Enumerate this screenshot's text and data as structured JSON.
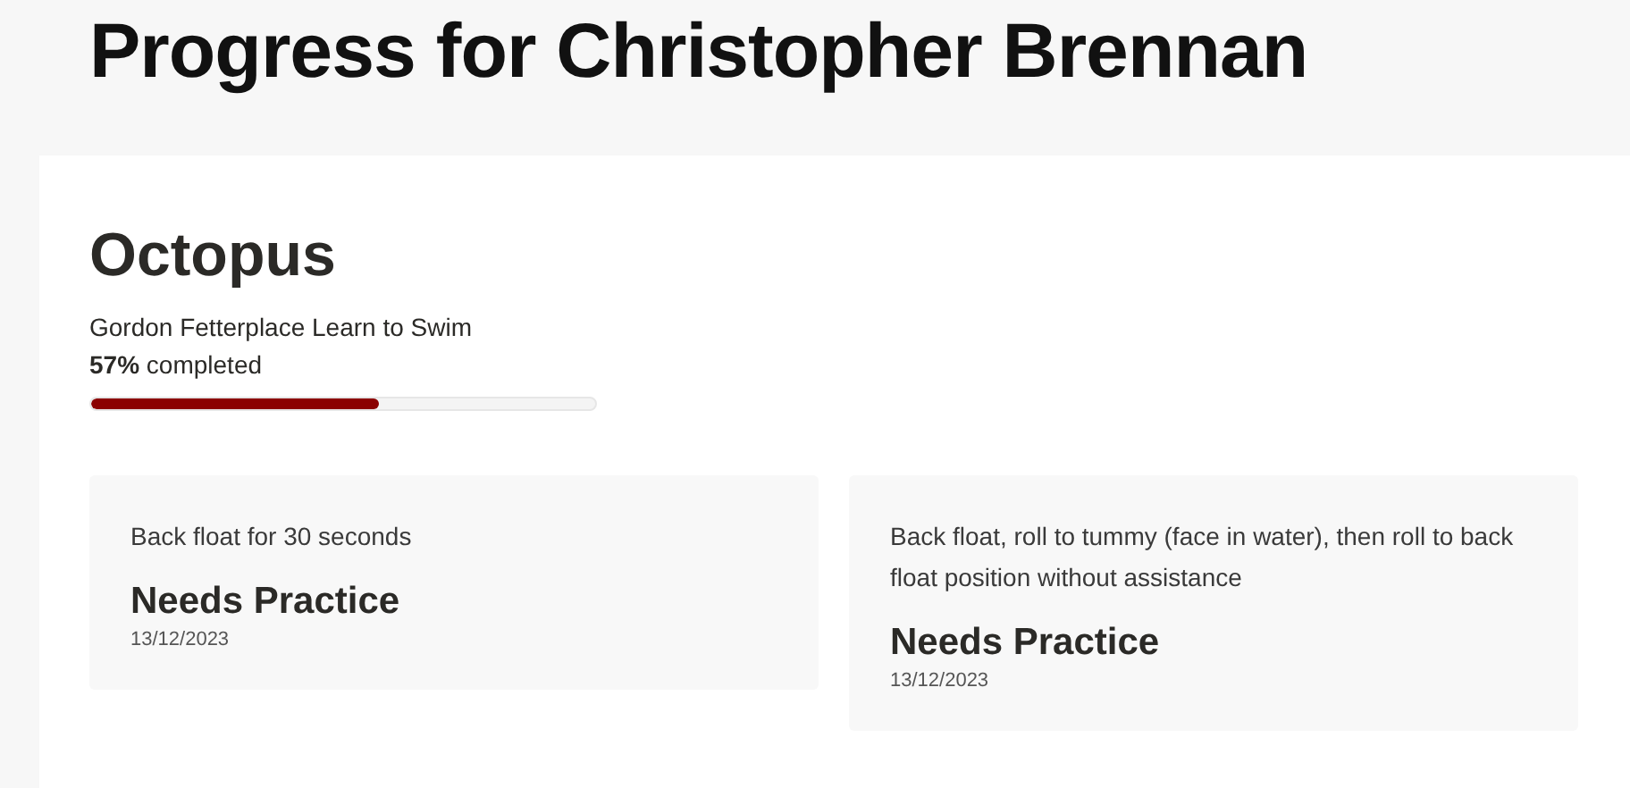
{
  "page_title": "Progress for Christopher Brennan",
  "level": {
    "name": "Octopus",
    "program": "Gordon Fetterplace Learn to Swim",
    "completion": "**57%** completed",
    "level": 0.57
  },
  "skills": [
    {
      "description": "Back float for 30 seconds",
      "status": "Needs Practice",
      "date": "13/12/2023"
    },
    {
      "description": "Back float, roll to tummy (face in water), then roll to back float position without assistance",
      "status": "Needs Practice",
      "date": "13/12/2023"
    }
  ]
}
